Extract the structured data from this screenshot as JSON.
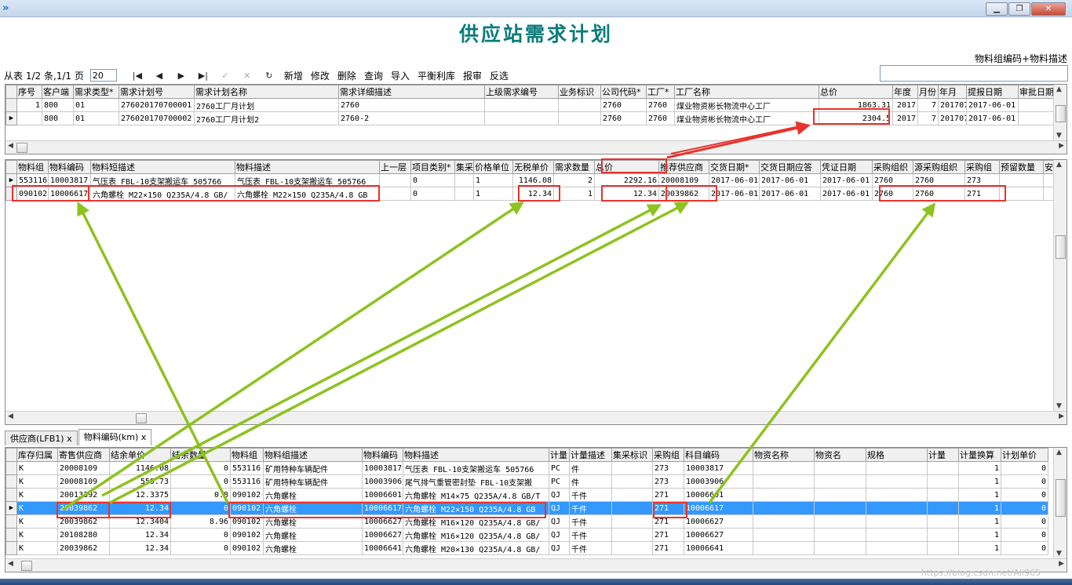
{
  "window": {
    "minimize": "▁",
    "restore": "❐",
    "close": "✕"
  },
  "page_title": "供应站需求计划",
  "search_label": "物料组编码+物料描述",
  "search_value": "",
  "toolbar": {
    "record_info": "从表 1/2 条,1/1 页",
    "page_size": "20",
    "first": "|◀",
    "prev": "◀",
    "next": "▶",
    "last": "▶|",
    "confirm": "✓",
    "cancel": "✕",
    "refresh": "↻",
    "buttons": [
      "新增",
      "修改",
      "删除",
      "查询",
      "导入",
      "平衡利库",
      "报审",
      "反选"
    ]
  },
  "grid1": {
    "columns": [
      "序号",
      "客户端",
      "需求类型*",
      "需求计划号",
      "需求计划名称",
      "需求详细描述",
      "上级需求编号",
      "业务标识",
      "公司代码*",
      "工厂*",
      "工厂名称",
      "总价",
      "年度",
      "月份",
      "年月",
      "提报日期",
      "审批日期"
    ],
    "rows": [
      {
        "marker": "",
        "cells": [
          "1",
          "800",
          "01",
          "276020170700001",
          "2760工厂月计划",
          "2760",
          "",
          "",
          "2760",
          "2760",
          "煤业物资彬长物流中心工厂",
          "1863.31",
          "2017",
          "7",
          "201707",
          "2017-06-01",
          ""
        ]
      },
      {
        "marker": "▶",
        "cells": [
          "",
          "800",
          "01",
          "276020170700002",
          "2760工厂月计划2",
          "2760-2",
          "",
          "",
          "2760",
          "2760",
          "煤业物资彬长物流中心工厂",
          "2304.5",
          "2017",
          "7",
          "201707",
          "2017-06-01",
          ""
        ]
      }
    ]
  },
  "grid2": {
    "columns": [
      "物料组",
      "物料编码",
      "物料短描述",
      "物料描述",
      "上一层",
      "项目类别*",
      "集采",
      "价格单位",
      "无税单价",
      "需求数量",
      "总价",
      "推荐供应商",
      "交货日期*",
      "交货日期应答",
      "凭证日期",
      "采购组织",
      "源采购组织",
      "采购组",
      "预留数量",
      "安"
    ],
    "rows": [
      {
        "marker": "▶",
        "cells": [
          "553116",
          "10003817",
          "气压表 FBL-10支架搬运车 505766",
          "气压表 FBL-10支架搬运车 505766",
          "",
          "0",
          "",
          "1",
          "1146.08",
          "2",
          "2292.16",
          "20008109",
          "2017-06-01",
          "2017-06-01",
          "2017-06-01",
          "2760",
          "2760",
          "273",
          "",
          ""
        ]
      },
      {
        "marker": "",
        "cells": [
          "090102",
          "10006617",
          "六角螺栓 M22×150 Q235A/4.8 GB/",
          "六角螺栓 M22×150 Q235A/4.8 GB",
          "",
          "0",
          "",
          "1",
          "12.34",
          "1",
          "12.34",
          "20039862",
          "2017-06-01",
          "2017-06-01",
          "2017-06-01",
          "2760",
          "2760",
          "271",
          "",
          ""
        ]
      }
    ]
  },
  "tabs": [
    "供应商(LFB1) x",
    "物料编码(km) x"
  ],
  "grid3": {
    "columns": [
      "库存归属",
      "寄售供应商",
      "结余单价",
      "结余数量",
      "物料组",
      "物料组描述",
      "物料编码",
      "物料描述",
      "计量",
      "计量描述",
      "集采标识",
      "采购组",
      "科目编码",
      "物资名称",
      "物资名",
      "规格",
      "计量",
      "计量换算",
      "计划单价"
    ],
    "rows": [
      {
        "marker": "",
        "cells": [
          "K",
          "20008109",
          "1146.08",
          "0",
          "553116",
          "矿用特种车辆配件",
          "10003817",
          "气压表 FBL-10支架搬运车 505766",
          "PC",
          "件",
          "",
          "273",
          "10003817",
          "",
          "",
          "",
          "",
          "1",
          "0"
        ]
      },
      {
        "marker": "",
        "cells": [
          "K",
          "20008109",
          "559.73",
          "0",
          "553116",
          "矿用特种车辆配件",
          "10003906",
          "尾气排气重管密封垫 FBL-10支架搬",
          "PC",
          "件",
          "",
          "273",
          "10003906",
          "",
          "",
          "",
          "",
          "1",
          "0"
        ]
      },
      {
        "marker": "",
        "cells": [
          "K",
          "20013392",
          "12.3375",
          "0.8",
          "090102",
          "六角螺栓",
          "10006601",
          "六角螺栓 M14×75 Q235A/4.8 GB/T",
          "QJ",
          "千件",
          "",
          "271",
          "10006601",
          "",
          "",
          "",
          "",
          "1",
          "0"
        ]
      },
      {
        "marker": "▶",
        "cells": [
          "K",
          "20039862",
          "12.34",
          "0",
          "090102",
          "六角螺栓",
          "10006617",
          "六角螺栓 M22×150 Q235A/4.8 GB",
          "QJ",
          "千件",
          "",
          "271",
          "10006617",
          "",
          "",
          "",
          "",
          "1",
          "0"
        ]
      },
      {
        "marker": "",
        "cells": [
          "K",
          "20039862",
          "12.3404",
          "8.96",
          "090102",
          "六角螺栓",
          "10006627",
          "六角螺栓 M16×120 Q235A/4.8 GB/",
          "QJ",
          "千件",
          "",
          "271",
          "10006627",
          "",
          "",
          "",
          "",
          "1",
          "0"
        ]
      },
      {
        "marker": "",
        "cells": [
          "K",
          "20108280",
          "12.34",
          "0",
          "090102",
          "六角螺栓",
          "10006627",
          "六角螺栓 M16×120 Q235A/4.8 GB/",
          "QJ",
          "千件",
          "",
          "271",
          "10006627",
          "",
          "",
          "",
          "",
          "1",
          "0"
        ]
      },
      {
        "marker": "",
        "cells": [
          "K",
          "20039862",
          "12.34",
          "0",
          "090102",
          "六角螺栓",
          "10006641",
          "六角螺栓 M20×130 Q235A/4.8 GB/",
          "QJ",
          "千件",
          "",
          "271",
          "10006641",
          "",
          "",
          "",
          "",
          "1",
          "0"
        ]
      }
    ],
    "selected_row": 3
  },
  "watermark": "https://blog.csdn.net/Ali965",
  "colors": {
    "title": "#0b7b7b",
    "selection": "#3399ff",
    "highlight_box": "#e8322c",
    "arrow_red": "#e8322c",
    "arrow_green": "#8ec21f"
  }
}
